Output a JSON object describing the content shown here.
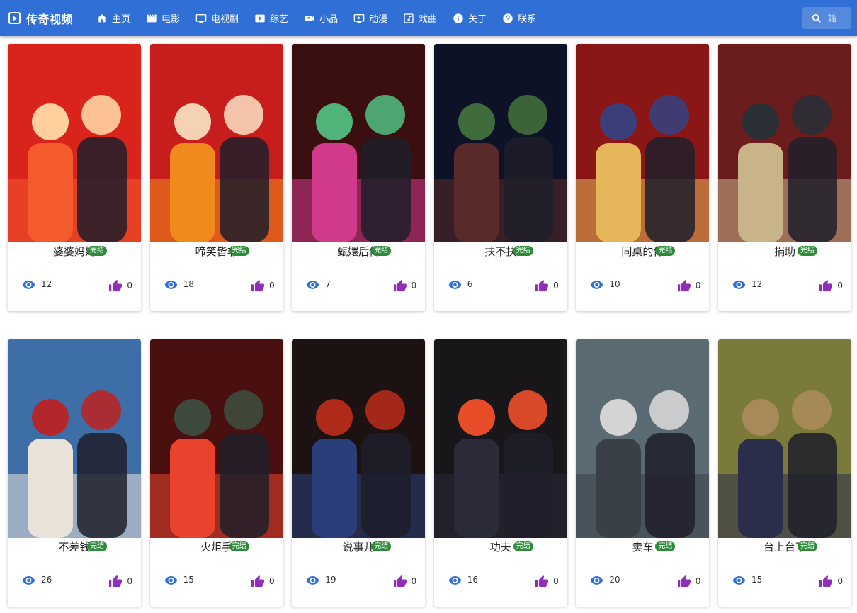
{
  "header": {
    "brand": "传奇视频",
    "nav": [
      {
        "label": "主页",
        "icon": "home-icon"
      },
      {
        "label": "电影",
        "icon": "movie-icon"
      },
      {
        "label": "电视剧",
        "icon": "tv-icon"
      },
      {
        "label": "综艺",
        "icon": "variety-play-icon"
      },
      {
        "label": "小品",
        "icon": "video-camera-icon"
      },
      {
        "label": "动漫",
        "icon": "anime-play-icon"
      },
      {
        "label": "戏曲",
        "icon": "music-note-icon"
      },
      {
        "label": "关于",
        "icon": "info-icon"
      },
      {
        "label": "联系",
        "icon": "help-icon"
      }
    ],
    "search_placeholder": "输"
  },
  "colors": {
    "appbar": "#2f6fd6",
    "badge": "#2e8b3a",
    "eye": "#2f6fd6",
    "like": "#8e2fb5"
  },
  "videos": [
    {
      "title": "婆婆妈妈",
      "badge": "完结",
      "views": "12",
      "likes": "0"
    },
    {
      "title": "啼笑皆非",
      "badge": "完结",
      "views": "18",
      "likes": "0"
    },
    {
      "title": "甄嬛后传",
      "badge": "完结",
      "views": "7",
      "likes": "0"
    },
    {
      "title": "扶不扶",
      "badge": "完结",
      "views": "6",
      "likes": "0"
    },
    {
      "title": "同桌的你",
      "badge": "完结",
      "views": "10",
      "likes": "0"
    },
    {
      "title": "捐助",
      "badge": "完结",
      "views": "12",
      "likes": "0"
    },
    {
      "title": "不差钱",
      "badge": "完结",
      "views": "26",
      "likes": "0"
    },
    {
      "title": "火炬手",
      "badge": "完结",
      "views": "15",
      "likes": "0"
    },
    {
      "title": "说事儿",
      "badge": "完结",
      "views": "19",
      "likes": "0"
    },
    {
      "title": "功夫",
      "badge": "完结",
      "views": "16",
      "likes": "0"
    },
    {
      "title": "卖车",
      "badge": "完结",
      "views": "20",
      "likes": "0"
    },
    {
      "title": "台上台下",
      "badge": "完结",
      "views": "15",
      "likes": "0"
    }
  ]
}
